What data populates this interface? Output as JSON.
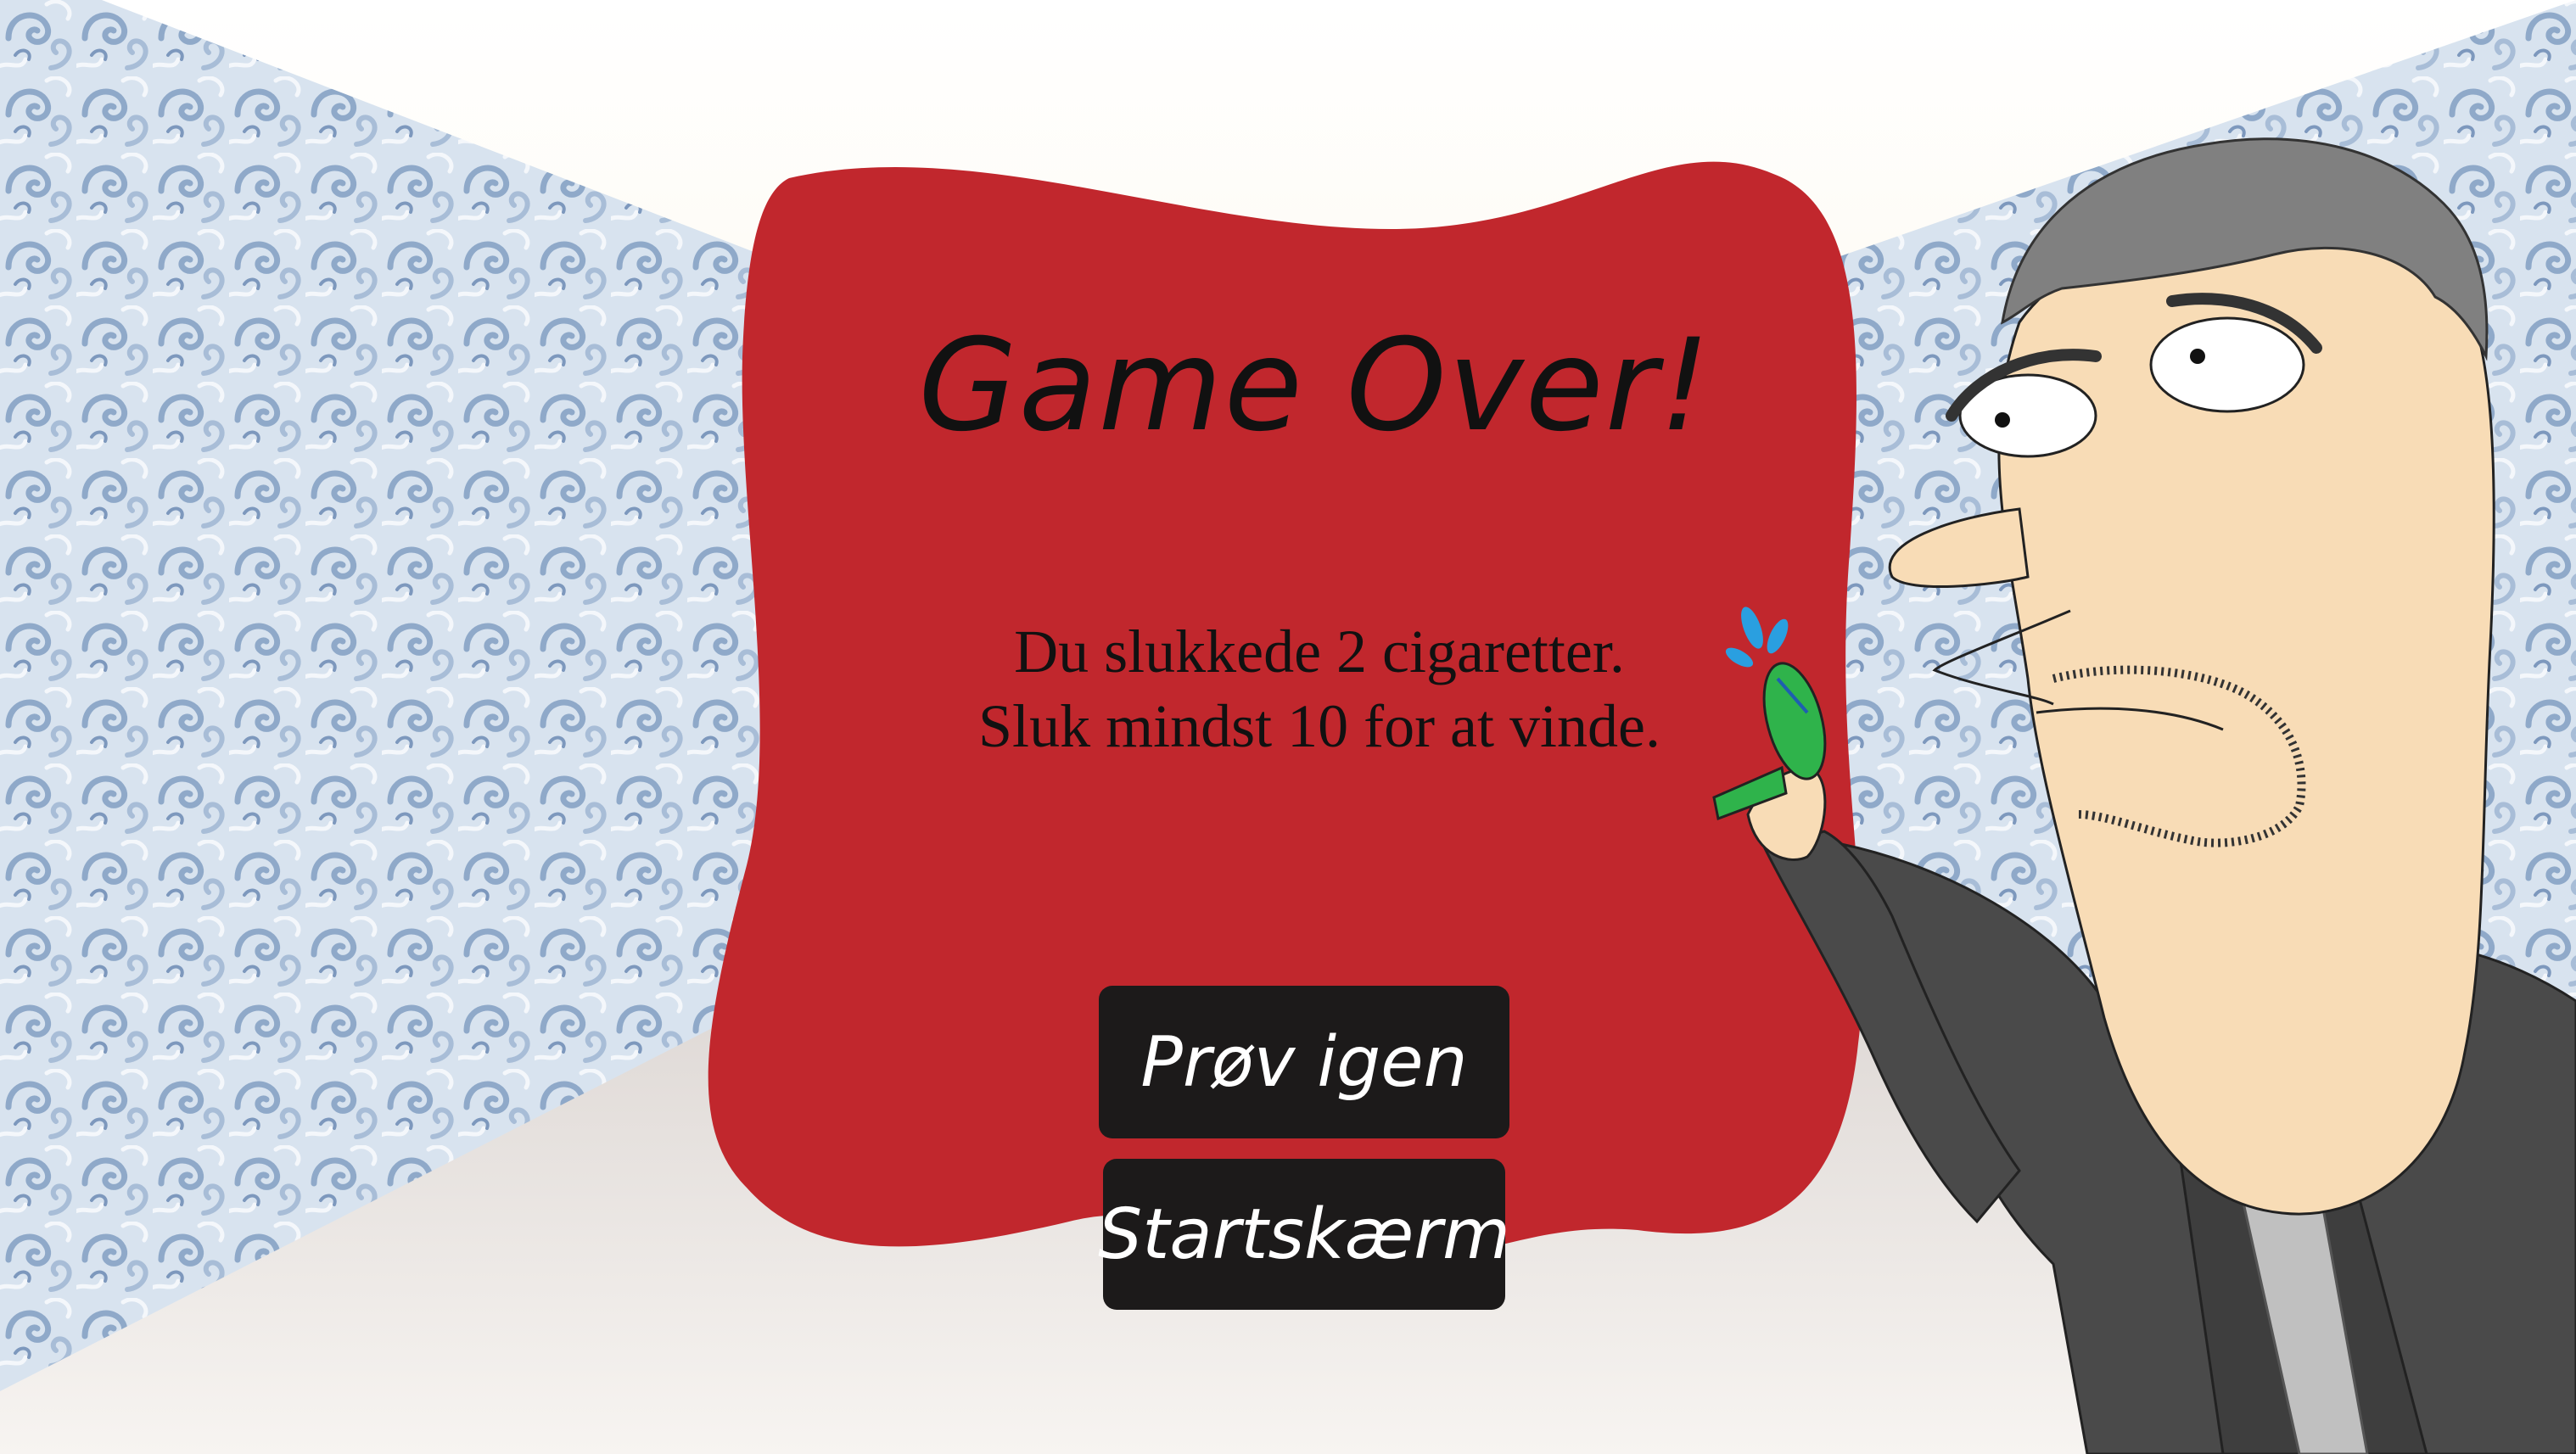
{
  "game_over": {
    "title": "Game Over!",
    "message": "Du slukkede 2 cigaretter. Sluk mindst 10 for at vinde.",
    "retry_label": "Prøv igen",
    "start_label": "Startskærm"
  },
  "colors": {
    "panel": "#c1272d",
    "button": "#1c1a1a",
    "wallpaper": "#b6c8de",
    "ceiling": "#fbf1d6",
    "floor": "#e6e0dc",
    "jacket": "#4a4a4a",
    "skin": "#f8dcb6",
    "hair": "#7f7f7f"
  },
  "icons": [
    "character-illustration",
    "water-pistol-icon",
    "water-splash-icon"
  ]
}
